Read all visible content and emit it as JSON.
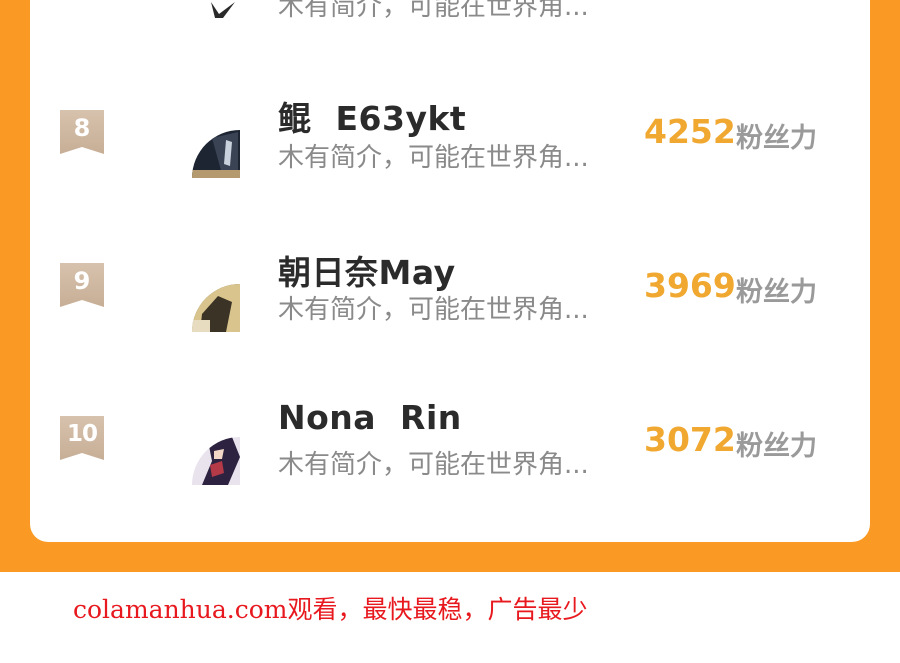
{
  "ranking": {
    "partial_top_row": {
      "bio": "木有简介，可能在世界角..."
    },
    "rows": [
      {
        "rank": "8",
        "name": "鲲  E63ykt",
        "bio": "木有简介，可能在世界角...",
        "fans_count": "4252",
        "fans_label": "粉丝力"
      },
      {
        "rank": "9",
        "name": "朝日奈May",
        "bio": "木有简介，可能在世界角...",
        "fans_count": "3969",
        "fans_label": "粉丝力"
      },
      {
        "rank": "10",
        "name": "Nona  Rin",
        "bio": "木有简介，可能在世界角...",
        "fans_count": "3072",
        "fans_label": "粉丝力"
      }
    ]
  },
  "footer": {
    "ad_text": "colamanhua.com观看，最快最稳，广告最少"
  },
  "colors": {
    "background_orange": "#fa9a24",
    "fans_count": "#f0a830",
    "rank_badge": "#c7ae96",
    "footer_text": "#e8191e"
  }
}
